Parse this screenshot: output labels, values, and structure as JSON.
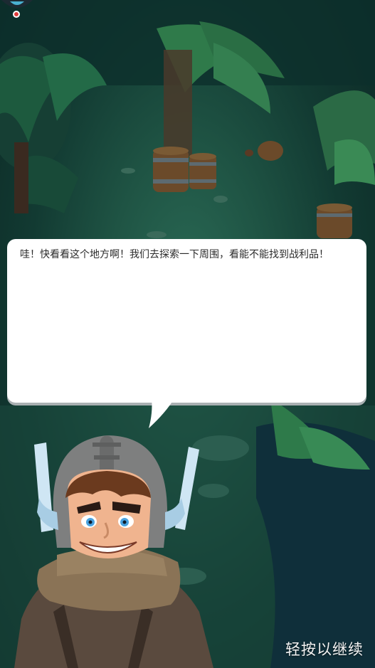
{
  "dialog": {
    "text": "哇！快看看这个地方啊！我们去探索一下周围，看能不能找到战利品！"
  },
  "hint": {
    "continue_label": "轻按以继续"
  },
  "colors": {
    "dialog_bg": "#ffffff",
    "dialog_shadow": "#a9b0b2",
    "hint_text": "#f4f4f4",
    "ground": "#1f5444"
  },
  "icons": {
    "top_marker": "map-marker-icon"
  }
}
